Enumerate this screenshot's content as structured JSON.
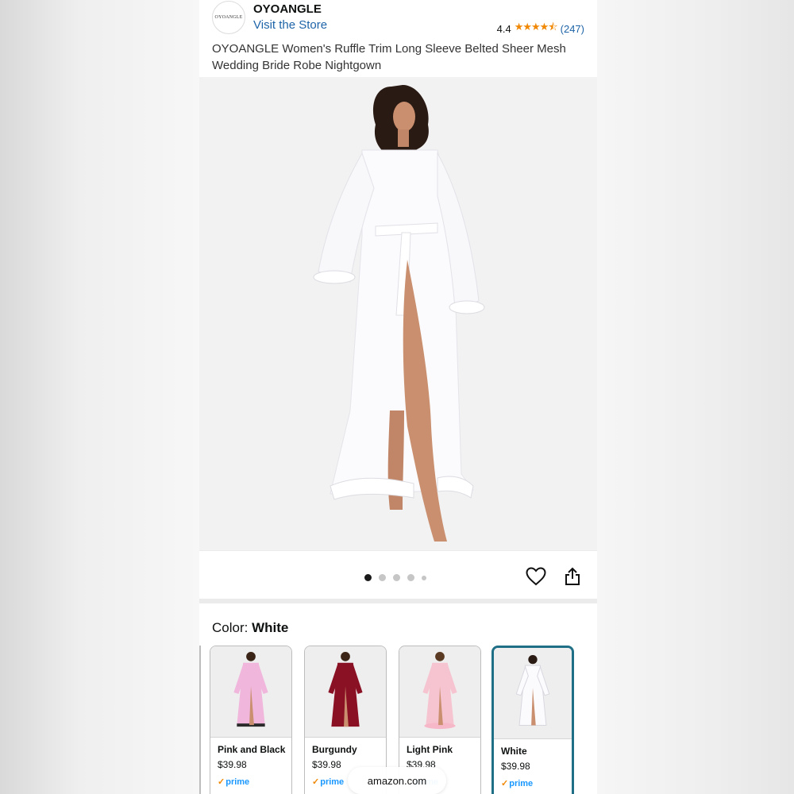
{
  "store": {
    "logo_text": "OYOANGLE",
    "brand": "OYOANGLE",
    "visit_link": "Visit the Store",
    "rating": "4.4",
    "rating_count": "(247)"
  },
  "product": {
    "title": "OYOANGLE Women's Ruffle Trim Long Sleeve Belted Sheer Mesh Wedding Bride Robe Nightgown",
    "image_count": 5,
    "active_image_index": 0
  },
  "color": {
    "label": "Color:",
    "selected": "White",
    "options": [
      {
        "name": "Pink and Black",
        "price": "$39.98",
        "prime": "prime",
        "robe_color": "#f0b6dc",
        "trim_color": "#2a2a2a"
      },
      {
        "name": "Burgundy",
        "price": "$39.98",
        "prime": "prime",
        "robe_color": "#8a1024",
        "trim_color": "#7a0e20"
      },
      {
        "name": "Light Pink",
        "price": "$39.98",
        "prime": "prime",
        "robe_color": "#f6c4d0",
        "trim_color": "#f6b8c8"
      },
      {
        "name": "White",
        "price": "$39.98",
        "prime": "prime",
        "robe_color": "#f4f4f6",
        "trim_color": "#ffffff"
      }
    ]
  },
  "browser": {
    "url": "amazon.com"
  },
  "colors": {
    "link": "#1e64a8",
    "star": "#f08804",
    "selected_border": "#1f6f86",
    "prime": "#1a98ff"
  }
}
